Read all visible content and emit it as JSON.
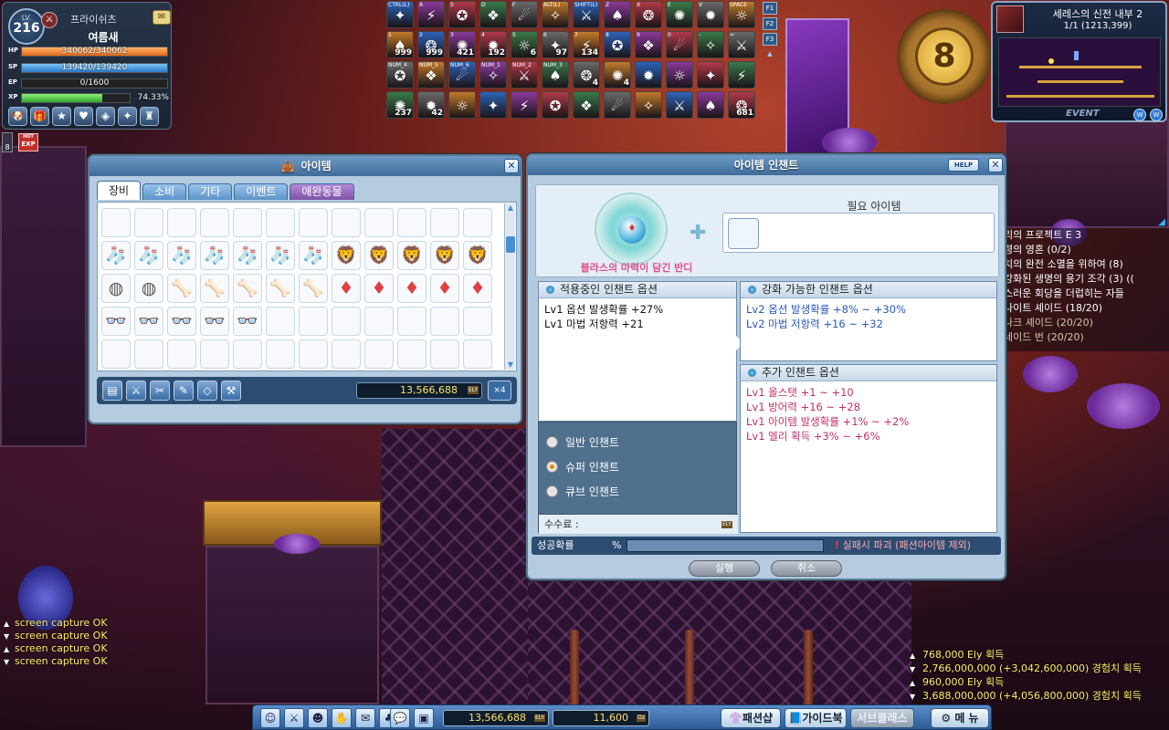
{
  "status": {
    "level_label": "LV.",
    "level": "216",
    "job": "프라이쉬츠",
    "name": "여름새",
    "hp_label": "HP",
    "hp": "340062/340062",
    "hp_fill": 1.0,
    "mp_label": "SP",
    "mp": "139420/139420",
    "mp_fill": 1.0,
    "ep_label": "EP",
    "ep": "0/1600",
    "ep_fill": 0.0,
    "xp_label": "XP",
    "xp": "74.33%",
    "xp_fill": 0.7433,
    "buff_count": "8",
    "exp_badge_top": "HOT",
    "exp_badge": "EXP"
  },
  "skillbar": {
    "row1": [
      {
        "key": "CTRL(L)",
        "icon": "skill"
      },
      {
        "key": "A",
        "icon": "skill"
      },
      {
        "key": "S",
        "icon": "skill"
      },
      {
        "key": "D",
        "icon": "skill"
      },
      {
        "key": "F",
        "icon": "skill"
      },
      {
        "key": "ALT(L)",
        "icon": "skill"
      },
      {
        "key": "SHIFT(L)",
        "icon": "skill"
      },
      {
        "key": "Z",
        "icon": "skill"
      },
      {
        "key": "X",
        "icon": "skill"
      },
      {
        "key": "E",
        "icon": "skill"
      },
      {
        "key": "V",
        "icon": "skill"
      },
      {
        "key": "SPACE",
        "icon": "skill"
      }
    ],
    "row2": [
      {
        "key": "1",
        "count": "999"
      },
      {
        "key": "2",
        "count": "999"
      },
      {
        "key": "3",
        "count": "421"
      },
      {
        "key": "4",
        "count": "192"
      },
      {
        "key": "5",
        "count": "6"
      },
      {
        "key": "6",
        "count": "97"
      },
      {
        "key": "7",
        "count": "134"
      },
      {
        "key": "8",
        "count": ""
      },
      {
        "key": "9",
        "count": ""
      },
      {
        "key": "0",
        "count": ""
      },
      {
        "key": "-",
        "count": ""
      },
      {
        "key": "=",
        "count": ""
      }
    ],
    "row3": [
      {
        "key": "NUM_4",
        "count": ""
      },
      {
        "key": "NUM_5",
        "count": ""
      },
      {
        "key": "NUM_6",
        "count": ""
      },
      {
        "key": "NUM_1",
        "count": ""
      },
      {
        "key": "NUM_2",
        "count": ""
      },
      {
        "key": "NUM_3",
        "count": ""
      },
      {
        "key": "",
        "count": "4"
      },
      {
        "key": "",
        "count": "4"
      },
      {
        "key": "",
        "count": ""
      },
      {
        "key": "",
        "count": ""
      },
      {
        "key": "",
        "count": ""
      },
      {
        "key": "",
        "count": ""
      }
    ],
    "row4": [
      {
        "key": "",
        "count": "237"
      },
      {
        "key": "",
        "count": "42"
      },
      {
        "key": "",
        "count": ""
      },
      {
        "key": "",
        "count": ""
      },
      {
        "key": "",
        "count": ""
      },
      {
        "key": "",
        "count": ""
      },
      {
        "key": "",
        "count": ""
      },
      {
        "key": "",
        "count": ""
      },
      {
        "key": "",
        "count": ""
      },
      {
        "key": "",
        "count": ""
      },
      {
        "key": "",
        "count": ""
      },
      {
        "key": "",
        "count": "681"
      }
    ],
    "fkeys": [
      "F1",
      "F2",
      "F3"
    ]
  },
  "emblem": {
    "number": "8"
  },
  "minimap": {
    "map_name": "세레스의 신전 내부 2",
    "coords": "1/1 (1213,399)",
    "event_label": "EVENT",
    "btn1": "W",
    "btn2": "W"
  },
  "quests": [
    {
      "text": "리의 프로젝트 E 3",
      "dim": false
    },
    {
      "text": "령의 영혼 (0/2)",
      "dim": false
    },
    {
      "text": "치의 완전 소멸을 위하여 (8)",
      "dim": false
    },
    {
      "text": "강화된 생명의 용기 조각 (3) ((",
      "dim": false
    },
    {
      "text": "스러운 회당을 더럽히는 자들",
      "dim": false
    },
    {
      "text": "나이트 셰이드 (18/20)",
      "dim": false
    },
    {
      "text": "나크 셰이드 (20/20)",
      "dim": true
    },
    {
      "text": "세이드 번 (20/20)",
      "dim": true
    }
  ],
  "inventory": {
    "title": "아이템",
    "tabs": [
      "장비",
      "소비",
      "기타",
      "이벤트",
      "애완동물"
    ],
    "active_tab": 0,
    "rows": [
      [
        "",
        "",
        "",
        "",
        "",
        "",
        "",
        "",
        "",
        "",
        "",
        ""
      ],
      [
        "sock",
        "sock",
        "sock",
        "sock",
        "sock",
        "sock",
        "sock",
        "cape",
        "cape",
        "cape",
        "cape",
        "cape"
      ],
      [
        "rock",
        "rock",
        "bone",
        "bone",
        "bone",
        "bone",
        "bone",
        "gem",
        "gem",
        "gem",
        "gem",
        "gem"
      ],
      [
        "glasses",
        "glasses",
        "glasses",
        "glasses",
        "glasses",
        "",
        "",
        "",
        "",
        "",
        "",
        ""
      ],
      [
        "",
        "",
        "",
        "",
        "",
        "",
        "",
        "",
        "",
        "",
        "",
        ""
      ]
    ],
    "meso": "13,566,688",
    "meso_unit": "ELY",
    "multiplier": "×4"
  },
  "enchant": {
    "title": "아이템 인챈트",
    "help": "HELP",
    "item_name": "블라스의 마력이 담긴 반디",
    "required_label": "필요 아이템",
    "current_title": "적용중인 인챈트 옵션",
    "current": [
      "Lv1 옵션 발생확률 +27%",
      "Lv1 마법 저항력 +21"
    ],
    "possible_title": "강화 가능한 인챈트 옵션",
    "possible": [
      "Lv2 옵션 발생확률 +8% ~ +30%",
      "Lv2 마법 저항력 +16 ~ +32"
    ],
    "additional_title": "추가 인챈트 옵션",
    "additional": [
      "Lv1 올스탯 +1 ~ +10",
      "Lv1 방어력 +16 ~ +28",
      "Lv1 아이템 발생확률 +1% ~ +2%",
      "Lv1 엘리 획득 +3% ~ +6%"
    ],
    "types": [
      {
        "label": "일반 인챈트",
        "selected": false
      },
      {
        "label": "슈퍼 인챈트",
        "selected": true
      },
      {
        "label": "큐브 인챈트",
        "selected": false
      }
    ],
    "fee_label": "수수료 :",
    "fee_unit": "ELY",
    "rate_label": "성공확률",
    "rate_pct": "%",
    "warn_mark": "!",
    "warn_text": "실패시 파괴 (패션아이템 제외)",
    "execute": "실행",
    "cancel": "취소"
  },
  "syslog": [
    "screen capture OK",
    "screen capture OK",
    "screen capture OK",
    "screen capture OK"
  ],
  "droplog": [
    "768,000 Ely 획득",
    "2,766,000,000 (+3,042,600,000) 경험치 획득",
    "960,000 Ely 획득",
    "3,688,000,000 (+4,056,800,000) 경험치 획득"
  ],
  "bottombar": {
    "meso": "13,566,688",
    "meso_unit": "ELY",
    "cash": "11,600",
    "cash_unit": "Oz",
    "fashion_shop": "패션샵",
    "guidebook": "가이드북",
    "subclass": "서브클래스",
    "menu": "메 뉴"
  }
}
